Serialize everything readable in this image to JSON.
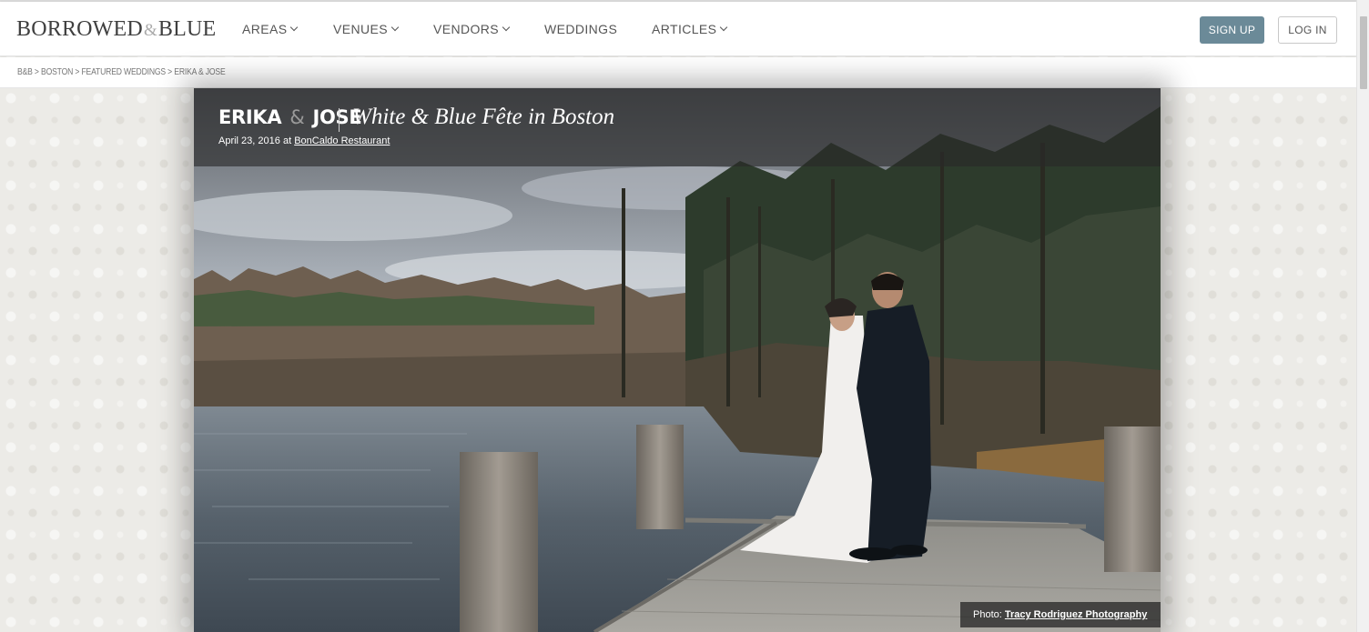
{
  "header": {
    "logo": {
      "part1": "BORROWED",
      "amp": "&",
      "part2": "BLUE"
    },
    "nav": [
      {
        "label": "AREAS",
        "dropdown": true
      },
      {
        "label": "VENUES",
        "dropdown": true
      },
      {
        "label": "VENDORS",
        "dropdown": true
      },
      {
        "label": "WEDDINGS",
        "dropdown": false
      },
      {
        "label": "ARTICLES",
        "dropdown": true
      }
    ],
    "signup_label": "SIGN UP",
    "login_label": "LOG IN"
  },
  "breadcrumb": {
    "items": [
      "B&B",
      "BOSTON",
      "FEATURED WEDDINGS",
      "ERIKA & JOSE"
    ],
    "separator": ">"
  },
  "feature": {
    "name1": "ERIKA",
    "amp": "&",
    "name2": "JOSE",
    "title": "White & Blue Fête in Boston",
    "date": "April 23, 2016",
    "at": "at",
    "venue": "BonCaldo Restaurant",
    "photo_prefix": "Photo:",
    "photographer": "Tracy Rodriguez Photography"
  },
  "colors": {
    "accent": "#6b8a98",
    "background": "#ecebe7",
    "band": "#282828"
  }
}
